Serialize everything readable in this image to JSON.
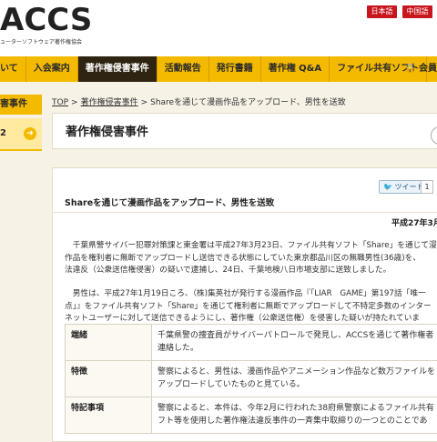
{
  "header": {
    "logo": "ACCS",
    "logo_sub": "ューターソフトウェア著作権協会",
    "lang_ja": "日本語",
    "lang_zh": "中国語"
  },
  "nav": {
    "items": [
      {
        "label": "いて",
        "active": false
      },
      {
        "label": "入会案内",
        "active": false
      },
      {
        "label": "著作権侵害事件",
        "active": true
      },
      {
        "label": "活動報告",
        "active": false
      },
      {
        "label": "発行書籍",
        "active": false
      },
      {
        "label": "著作権 Q&A",
        "active": false
      },
      {
        "label": "ファイル共有ソフト",
        "active": false
      }
    ],
    "member": "会員"
  },
  "sidebar": {
    "title": "害事件",
    "item_label": "2"
  },
  "breadcrumb": {
    "top": "TOP",
    "section": "著作権侵害事件",
    "current": "Shareを通じて漫画作品をアップロード、男性を送致",
    "sep": ">"
  },
  "page_title": "著作権侵害事件",
  "article": {
    "tweet_label": "ツイート",
    "tweet_count": "1",
    "title": "Shareを通じて漫画作品をアップロード、男性を送致",
    "date": "平成27年3月",
    "para1": [
      "　千葉県警サイバー犯罪対策課と東金署は平成27年3月23日、ファイル共有ソフト「Share」を通じて漫",
      "作品を権利者に無断でアップロードし送信できる状態にしていた東京都品川区の無職男性(36歳)を、",
      "法違反（公衆送信権侵害）の疑いで逮捕し、24日、千葉地検八日市場支部に送致しました。"
    ],
    "para2": [
      "　男性は、平成27年1月19日ころ、（株)集英社が発行する漫画作品『「LIAR　GAME」第197話「唯一",
      "点」』をファイル共有ソフト「Share」を通じて権利者に無断でアップロードして不特定多数のインター",
      "ネットユーザーに対して送信できるようにし、著作権（公衆送信権）を侵害した疑いが持たれていま"
    ],
    "table": [
      {
        "label": "端緒",
        "lines": [
          "千葉県警の捜査員がサイバーパトロールで発見し、ACCSを通じて著作権者",
          "連絡した。"
        ]
      },
      {
        "label": "特徴",
        "lines": [
          "警察によると、男性は、漫画作品やアニメーション作品など数万ファイルを",
          "アップロードしていたものと見ている。"
        ]
      },
      {
        "label": "特記事項",
        "lines": [
          "警察によると、本件は、今年2月に行われた38府県警察によるファイル共有",
          "フト等を使用した著作権法違反事件の一斉集中取締りの一つとのことであ"
        ]
      }
    ]
  }
}
